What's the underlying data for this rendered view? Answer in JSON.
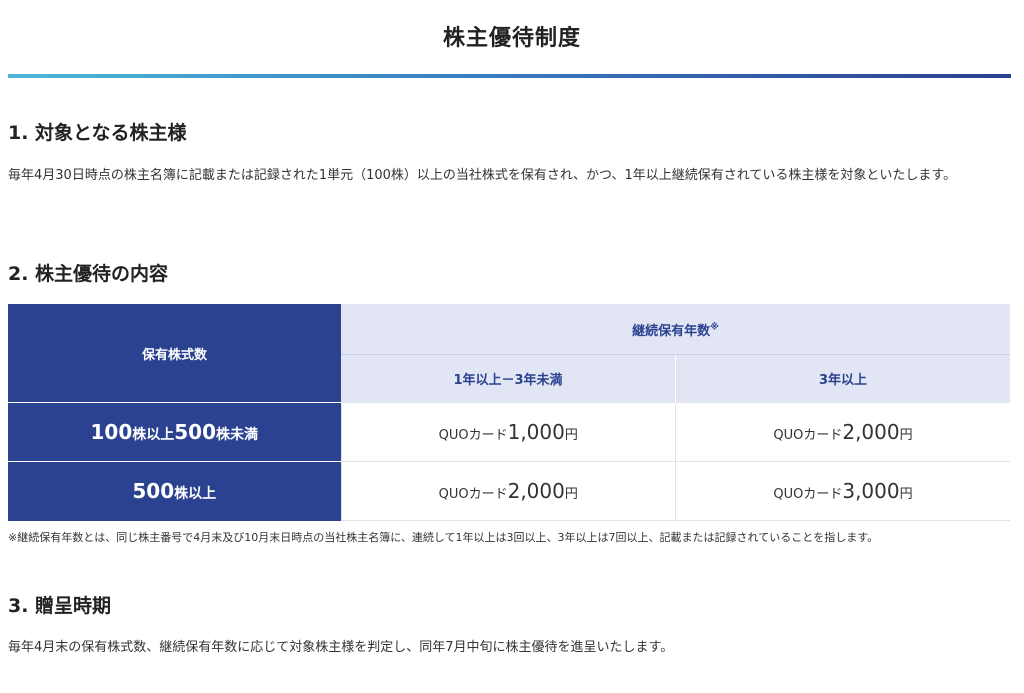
{
  "page": {
    "title": "株主優待制度"
  },
  "section1": {
    "heading": "1. 対象となる株主様",
    "body": "毎年4月30日時点の株主名簿に記載または記録された1単元（100株）以上の当社株式を保有され、かつ、1年以上継続保有されている株主様を対象といたします。"
  },
  "section2": {
    "heading": "2. 株主優待の内容",
    "table": {
      "col_shares": "保有株式数",
      "col_years": "継続保有年数",
      "col_years_mark": "※",
      "sub_cols": [
        "1年以上－3年未満",
        "3年以上"
      ],
      "rows": [
        {
          "label_a": "100",
          "label_a_unit": "株以上",
          "label_b": "500",
          "label_b_unit": "株未満",
          "cells": [
            {
              "prefix": "QUOカード",
              "amount": "1,000",
              "unit": "円"
            },
            {
              "prefix": "QUOカード",
              "amount": "2,000",
              "unit": "円"
            }
          ]
        },
        {
          "label_a": "500",
          "label_a_unit": "株以上",
          "cells": [
            {
              "prefix": "QUOカード",
              "amount": "2,000",
              "unit": "円"
            },
            {
              "prefix": "QUOカード",
              "amount": "3,000",
              "unit": "円"
            }
          ]
        }
      ]
    },
    "note": "※継続保有年数とは、同じ株主番号で4月末及び10月末日時点の当社株主名簿に、連続して1年以上は3回以上、3年以上は7回以上、記載または記録されていることを指します。"
  },
  "section3": {
    "heading": "3. 贈呈時期",
    "body": "毎年4月末の保有株式数、継続保有年数に応じて対象株主様を判定し、同年7月中旬に株主優待を進呈いたします。"
  },
  "colors": {
    "navy": "#2b4290",
    "header_light": "#e1e5f4",
    "rule_start": "#4cb8d8",
    "rule_end": "#2b3f8f"
  }
}
